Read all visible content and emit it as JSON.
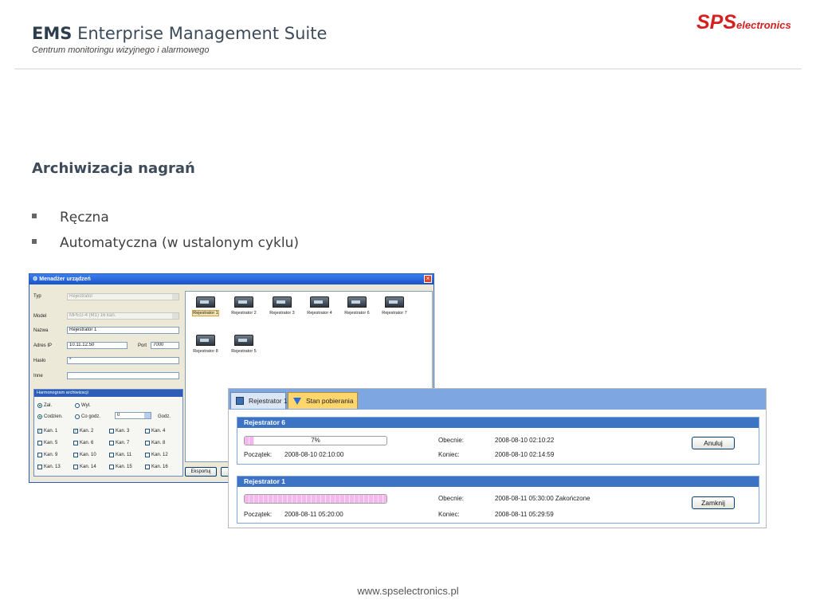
{
  "header": {
    "title_bold": "EMS",
    "title_rest": "Enterprise Management Suite",
    "subtitle": "Centrum monitoringu wizyjnego i alarmowego",
    "logo_main": "SPS",
    "logo_sub": "electronics",
    "brand_color": "#d61f1f"
  },
  "section": {
    "title": "Archiwizacja nagrań",
    "bullets": [
      "Ręczna",
      "Automatyczna (w ustalonym cyklu)"
    ]
  },
  "device_manager": {
    "title": "Menadżer urządzeń",
    "close_icon": "close-icon",
    "form": {
      "type_label": "Typ",
      "type_value": "Rejestrator",
      "model_label": "Model",
      "model_value": "MPEG-4 (M1) 16 kan.",
      "name_label": "Nazwa",
      "name_value": "Rejestrator 1",
      "ip_label": "Adres IP",
      "ip_value": "10.11.12.50",
      "port_label": "Port",
      "port_value": "7000",
      "password_label": "Hasło",
      "password_value": "*",
      "other_label": "Inne",
      "other_value": ""
    },
    "schedule": {
      "title": "Harmonogram archiwizacji",
      "on_label": "Zał.",
      "off_label": "Wył.",
      "daily_label": "Codzien.",
      "every_label": "Co godz.",
      "hours_value": "0",
      "hours_label": "Godz.",
      "channels": [
        {
          "label": "Kan. 1",
          "checked": true
        },
        {
          "label": "Kan. 2",
          "checked": true
        },
        {
          "label": "Kan. 3",
          "checked": false
        },
        {
          "label": "Kan. 4",
          "checked": false
        },
        {
          "label": "Kan. 5",
          "checked": false
        },
        {
          "label": "Kan. 6",
          "checked": false
        },
        {
          "label": "Kan. 7",
          "checked": false
        },
        {
          "label": "Kan. 8",
          "checked": false
        },
        {
          "label": "Kan. 9",
          "checked": false
        },
        {
          "label": "Kan. 10",
          "checked": false
        },
        {
          "label": "Kan. 11",
          "checked": false
        },
        {
          "label": "Kan. 12",
          "checked": false
        },
        {
          "label": "Kan. 13",
          "checked": false
        },
        {
          "label": "Kan. 14",
          "checked": false
        },
        {
          "label": "Kan. 15",
          "checked": false
        },
        {
          "label": "Kan. 16",
          "checked": false
        }
      ]
    },
    "devices": [
      "Rejestrator 1",
      "Rejestrator 2",
      "Rejestrator 3",
      "Rejestrator 4",
      "Rejestrator 6",
      "Rejestrator 7",
      "Rejestrator 8",
      "Rejestrator 5"
    ],
    "export_label": "Eksportuj"
  },
  "download_status": {
    "tabs": [
      "Rejestrator 1",
      "Stan pobierania"
    ],
    "jobs": [
      {
        "name": "Rejestrator 6",
        "progress_text": "7%",
        "progress": 0.07,
        "current_label": "Obecnie:",
        "current_value": "2008-08-10 02:10:22",
        "start_label": "Początek:",
        "start_value": "2008-08-10 02:10:00",
        "end_label": "Koniec:",
        "end_value": "2008-08-10 02:14:59",
        "button": "Anuluj"
      },
      {
        "name": "Rejestrator 1",
        "progress_text": "",
        "progress": 1.0,
        "current_label": "Obecnie:",
        "current_value": "2008-08-11 05:30:00 Zakończone",
        "start_label": "Początek:",
        "start_value": "2008-08-11 05:20:00",
        "end_label": "Koniec:",
        "end_value": "2008-08-11 05:29:59",
        "button": "Zamknij"
      }
    ]
  },
  "footer": {
    "url": "www.spselectronics.pl"
  }
}
